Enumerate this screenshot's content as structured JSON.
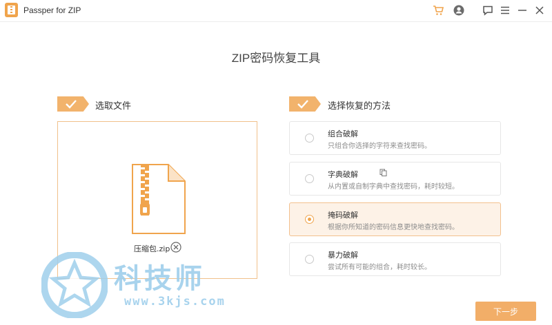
{
  "window": {
    "title": "Passper for ZIP",
    "icons": [
      "cart-icon",
      "account-icon",
      "feedback-icon",
      "menu-icon",
      "minimize-icon",
      "close-icon"
    ]
  },
  "page": {
    "title": "ZIP密码恢复工具"
  },
  "steps": {
    "select_file": {
      "label": "选取文件"
    },
    "select_method": {
      "label": "选择恢复的方法"
    }
  },
  "file": {
    "name": "压缩包.zip"
  },
  "methods": [
    {
      "name": "组合破解",
      "desc": "只组合你选择的字符来查找密码。",
      "selected": false
    },
    {
      "name": "字典破解",
      "desc": "从内置或自制字典中查找密码，耗时较短。",
      "selected": false
    },
    {
      "name": "掩码破解",
      "desc": "根据你所知道的密码信息更快地查找密码。",
      "selected": true
    },
    {
      "name": "暴力破解",
      "desc": "尝试所有可能的组合，耗时较长。",
      "selected": false
    }
  ],
  "next_button": {
    "label": "下一步"
  },
  "watermark": {
    "text": "科技师",
    "url": "www.3kjs.com"
  },
  "colors": {
    "accent": "#f2ae68",
    "badge": "#f2b36c",
    "selected_bg": "#fdf2e7",
    "selected_border": "#f2c08d",
    "watermark": "#9fcfec"
  }
}
